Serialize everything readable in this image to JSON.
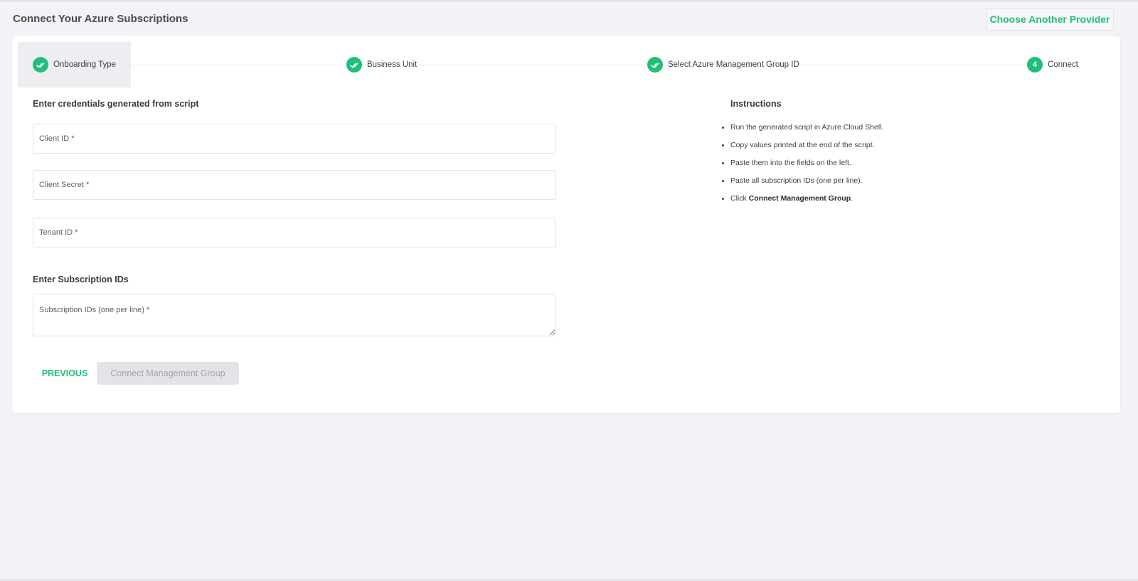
{
  "header": {
    "title": "Connect Your Azure Subscriptions",
    "choose_provider_label": "Choose Another Provider"
  },
  "stepper": {
    "steps": [
      {
        "label": "Onboarding Type",
        "status": "completed",
        "icon": "double-check-icon"
      },
      {
        "label": "Business Unit",
        "status": "completed",
        "icon": "double-check-icon"
      },
      {
        "label": "Select Azure Management Group ID",
        "status": "completed",
        "icon": "double-check-icon"
      },
      {
        "label": "Connect",
        "status": "current",
        "number": "4"
      }
    ]
  },
  "credentials": {
    "heading": "Enter credentials generated from script",
    "client_id": {
      "placeholder": "Client ID *",
      "value": ""
    },
    "client_secret": {
      "placeholder": "Client Secret *",
      "value": ""
    },
    "tenant_id": {
      "placeholder": "Tenant ID *",
      "value": ""
    }
  },
  "subscriptions": {
    "heading": "Enter Subscription IDs",
    "ids": {
      "placeholder": "Subscription IDs (one per line) *",
      "value": ""
    }
  },
  "actions": {
    "previous_label": "PREVIOUS",
    "connect_label": "Connect Management Group"
  },
  "instructions": {
    "title": "Instructions",
    "items": [
      "Run the generated script in Azure Cloud Shell.",
      "Copy values printed at the end of the script.",
      "Paste them into the fields on the left.",
      "Paste all subscription IDs (one per line)."
    ],
    "last_item": {
      "prefix": "Click ",
      "emphasis": "Connect Management Group",
      "suffix": "."
    }
  },
  "colors": {
    "accent": "#1fbf7a",
    "background": "#f3f3f7",
    "card": "#ffffff",
    "disabled_button": "#e4e4e8"
  }
}
